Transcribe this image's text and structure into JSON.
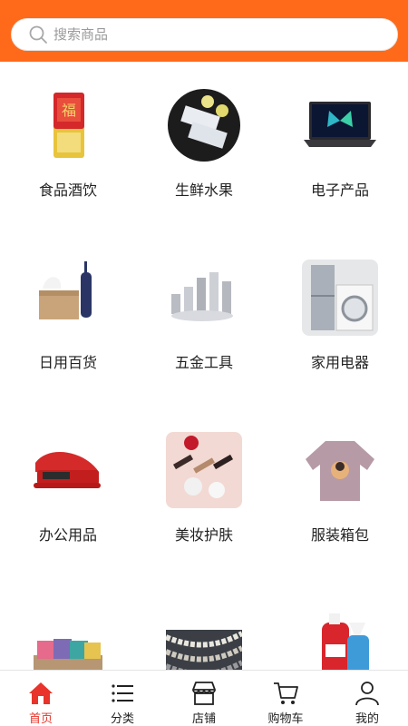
{
  "search": {
    "placeholder": "搜索商品"
  },
  "categories": [
    {
      "label": "食品酒饮",
      "icon": "rice-bag-icon"
    },
    {
      "label": "生鲜水果",
      "icon": "fish-plate-icon"
    },
    {
      "label": "电子产品",
      "icon": "laptop-icon"
    },
    {
      "label": "日用百货",
      "icon": "tissue-umbrella-icon"
    },
    {
      "label": "五金工具",
      "icon": "bolts-icon"
    },
    {
      "label": "家用电器",
      "icon": "appliance-icon"
    },
    {
      "label": "办公用品",
      "icon": "stapler-icon"
    },
    {
      "label": "美妆护肤",
      "icon": "cosmetics-icon"
    },
    {
      "label": "服装箱包",
      "icon": "sweater-icon"
    },
    {
      "label": "",
      "icon": "cushions-icon"
    },
    {
      "label": "",
      "icon": "pearls-icon"
    },
    {
      "label": "",
      "icon": "detergent-icon"
    }
  ],
  "tabbar": [
    {
      "label": "首页",
      "icon": "home-icon",
      "active": true
    },
    {
      "label": "分类",
      "icon": "list-icon",
      "active": false
    },
    {
      "label": "店铺",
      "icon": "store-icon",
      "active": false
    },
    {
      "label": "购物车",
      "icon": "cart-icon",
      "active": false
    },
    {
      "label": "我的",
      "icon": "user-icon",
      "active": false
    }
  ],
  "colors": {
    "header": "#ff6a1a",
    "active_tab": "#e8342a"
  }
}
